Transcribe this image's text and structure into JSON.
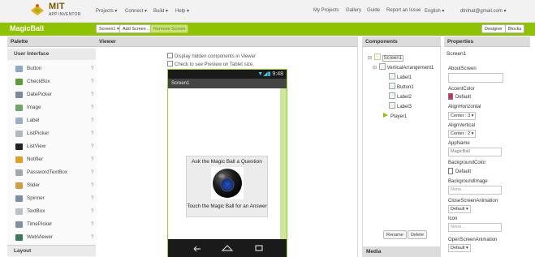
{
  "brand": {
    "name": "MIT",
    "subtitle": "APP INVENTOR"
  },
  "top_nav": {
    "projects": "Projects ▾",
    "connect": "Connect ▾",
    "build": "Build ▾",
    "help": "Help ▾",
    "my_projects": "My Projects",
    "gallery": "Gallery",
    "guide": "Guide",
    "report_issue": "Report an Issue",
    "language": "English ▾",
    "user": "dtmhat@gmail.com ▾"
  },
  "title_bar": {
    "project_name": "MagicBall",
    "screen_select": "Screen1 ▾",
    "add_screen": "Add Screen ...",
    "remove_screen": "Remove Screen",
    "designer": "Designer",
    "blocks": "Blocks"
  },
  "palette": {
    "header": "Palette",
    "category": "User Interface",
    "items": [
      {
        "label": "Button",
        "icon": "button-icon",
        "color": "#8fa8c8"
      },
      {
        "label": "CheckBox",
        "icon": "checkbox-icon",
        "color": "#5a9e3a"
      },
      {
        "label": "DatePicker",
        "icon": "datepicker-icon",
        "color": "#7a8aa0"
      },
      {
        "label": "Image",
        "icon": "image-icon",
        "color": "#6aa86a"
      },
      {
        "label": "Label",
        "icon": "label-icon",
        "color": "#9ab0c8"
      },
      {
        "label": "ListPicker",
        "icon": "listpicker-icon",
        "color": "#b0b8c0"
      },
      {
        "label": "ListView",
        "icon": "listview-icon",
        "color": "#222222"
      },
      {
        "label": "Notifier",
        "icon": "notifier-icon",
        "color": "#e0a020"
      },
      {
        "label": "PasswordTextBox",
        "icon": "password-icon",
        "color": "#a0a8b0"
      },
      {
        "label": "Slider",
        "icon": "slider-icon",
        "color": "#d0a040"
      },
      {
        "label": "Spinner",
        "icon": "spinner-icon",
        "color": "#7890a8"
      },
      {
        "label": "TextBox",
        "icon": "textbox-icon",
        "color": "#b8c0c8"
      },
      {
        "label": "TimePicker",
        "icon": "timepicker-icon",
        "color": "#8090a0"
      },
      {
        "label": "WebViewer",
        "icon": "webviewer-icon",
        "color": "#3a7a5a"
      }
    ],
    "help_glyph": "?",
    "layout_category": "Layout"
  },
  "viewer": {
    "header": "Viewer",
    "hidden_components": "Display hidden components in Viewer",
    "tablet_preview": "Check to see Preview on Tablet size.",
    "status_time": "9:48",
    "screen_title": "Screen1",
    "label_question": "Ask the Magic Ball a Question",
    "label_answer": "Touch the Magic Ball for an Answer"
  },
  "components": {
    "header": "Components",
    "tree": [
      {
        "label": "Screen1",
        "level": 0,
        "toggle": "⊟"
      },
      {
        "label": "VerticalArrangement1",
        "level": 1,
        "toggle": "⊟"
      },
      {
        "label": "Label1",
        "level": 2,
        "toggle": ""
      },
      {
        "label": "Button1",
        "level": 2,
        "toggle": ""
      },
      {
        "label": "Label2",
        "level": 2,
        "toggle": ""
      },
      {
        "label": "Label3",
        "level": 2,
        "toggle": ""
      },
      {
        "label": "Player1",
        "level": 1,
        "toggle": ""
      }
    ],
    "rename": "Rename",
    "delete": "Delete",
    "media_header": "Media"
  },
  "properties": {
    "header": "Properties",
    "component": "Screen1",
    "about_screen_label": "AboutScreen",
    "accent_color_label": "AccentColor",
    "accent_color_value": "Default",
    "accent_color_swatch": "#e0245e",
    "align_horizontal_label": "AlignHorizontal",
    "align_horizontal_value": "Center : 3 ▾",
    "align_vertical_label": "AlignVertical",
    "align_vertical_value": "Center : 2 ▾",
    "app_name_label": "AppName",
    "app_name_value": "MagicBall",
    "background_color_label": "BackgroundColor",
    "background_color_value": "Default",
    "background_color_swatch": "#ffffff",
    "background_image_label": "BackgroundImage",
    "background_image_value": "None...",
    "close_screen_animation_label": "CloseScreenAnimation",
    "close_screen_animation_value": "Default ▾",
    "icon_label": "Icon",
    "icon_value": "None...",
    "open_screen_animation_label": "OpenScreenAnimation",
    "open_screen_animation_value": "Default ▾"
  },
  "colors": {
    "brand_green": "#8fc202",
    "panel_header": "#dcdcdc"
  }
}
